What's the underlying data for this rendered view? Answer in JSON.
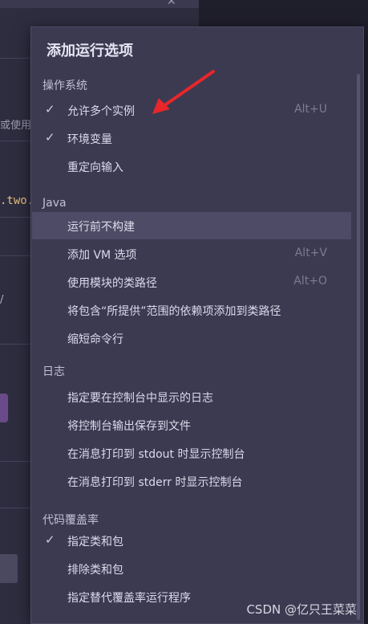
{
  "background": {
    "partial_text": "或使用",
    "code_fragment": ".two.",
    "slash": "/"
  },
  "popup": {
    "title": "添加运行选项",
    "groups": [
      {
        "name": "操作系统",
        "items": [
          {
            "label": "允许多个实例",
            "checked": true,
            "shortcut": "Alt+U"
          },
          {
            "label": "环境变量",
            "checked": true,
            "shortcut": ""
          },
          {
            "label": "重定向输入",
            "checked": false,
            "shortcut": ""
          }
        ]
      },
      {
        "name": "Java",
        "items": [
          {
            "label": "运行前不构建",
            "checked": false,
            "shortcut": "",
            "selected": true
          },
          {
            "label": "添加 VM 选项",
            "checked": false,
            "shortcut": "Alt+V"
          },
          {
            "label": "使用模块的类路径",
            "checked": false,
            "shortcut": "Alt+O"
          },
          {
            "label": "将包含“所提供”范围的依赖项添加到类路径",
            "checked": false,
            "shortcut": ""
          },
          {
            "label": "缩短命令行",
            "checked": false,
            "shortcut": ""
          }
        ]
      },
      {
        "name": "日志",
        "items": [
          {
            "label": "指定要在控制台中显示的日志",
            "checked": false,
            "shortcut": ""
          },
          {
            "label": "将控制台输出保存到文件",
            "checked": false,
            "shortcut": ""
          },
          {
            "label": "在消息打印到 stdout 时显示控制台",
            "checked": false,
            "shortcut": ""
          },
          {
            "label": "在消息打印到 stderr 时显示控制台",
            "checked": false,
            "shortcut": ""
          }
        ]
      },
      {
        "name": "代码覆盖率",
        "items": [
          {
            "label": "指定类和包",
            "checked": true,
            "shortcut": ""
          },
          {
            "label": "排除类和包",
            "checked": false,
            "shortcut": ""
          },
          {
            "label": "指定替代覆盖率运行程序",
            "checked": false,
            "shortcut": ""
          }
        ]
      }
    ],
    "check_glyph": "✓"
  },
  "watermark": "CSDN @亿只王菜菜",
  "colors": {
    "popup_bg": "#3b3a51",
    "selected_bg": "#4d4b66",
    "arrow": "#e8262b"
  }
}
